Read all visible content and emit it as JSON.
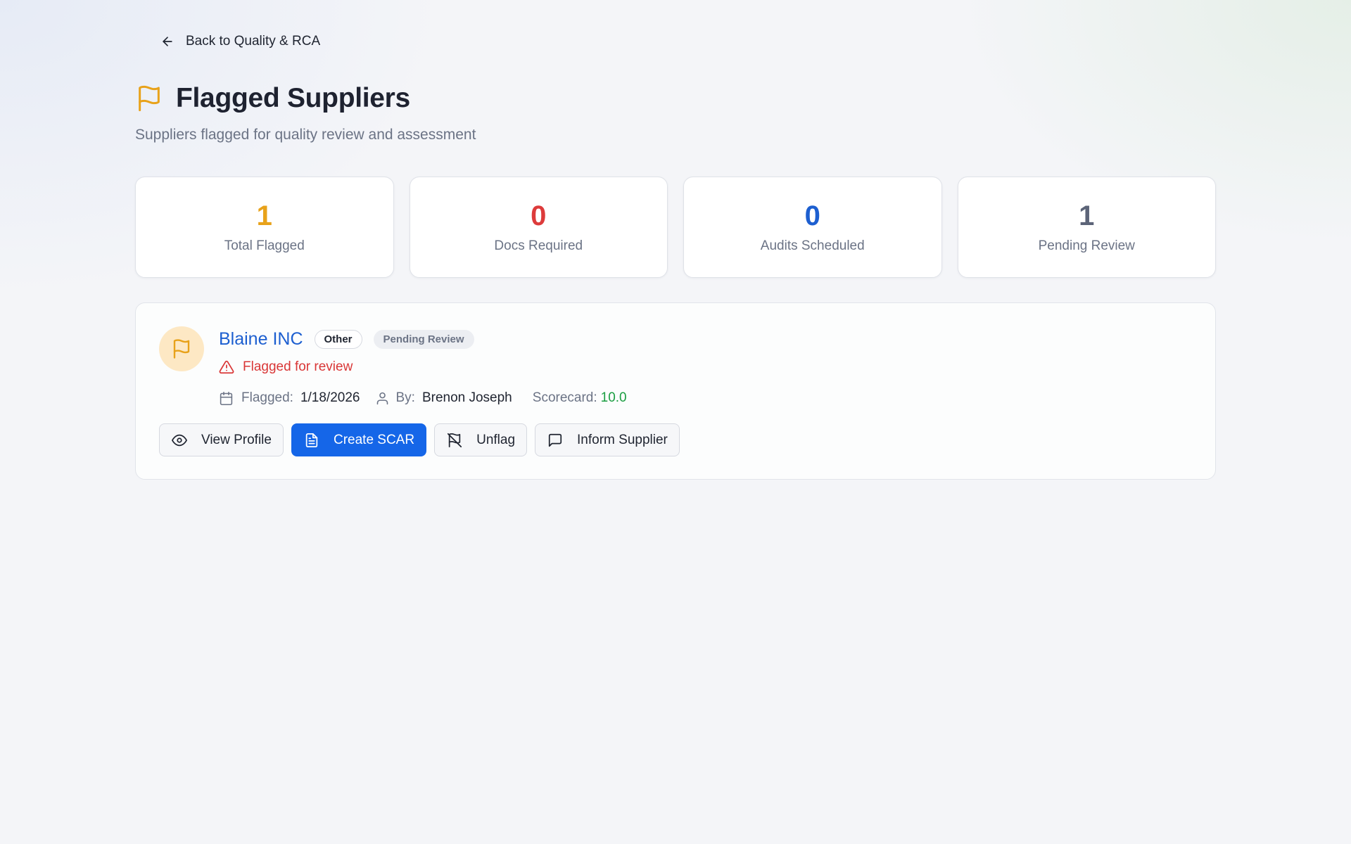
{
  "nav": {
    "back_label": "Back to Quality & RCA"
  },
  "header": {
    "title": "Flagged Suppliers",
    "subtitle": "Suppliers flagged for quality review and assessment"
  },
  "stats": [
    {
      "value": "1",
      "label": "Total Flagged",
      "color": "#e8a21a"
    },
    {
      "value": "0",
      "label": "Docs Required",
      "color": "#dd3b3b"
    },
    {
      "value": "0",
      "label": "Audits Scheduled",
      "color": "#1d5fd0"
    },
    {
      "value": "1",
      "label": "Pending Review",
      "color": "#5c6478"
    }
  ],
  "supplier": {
    "name": "Blaine INC",
    "category": "Other",
    "status": "Pending Review",
    "flag_note": "Flagged for review",
    "flagged_label": "Flagged:",
    "flagged_date": "1/18/2026",
    "by_label": "By:",
    "by_name": "Brenon Joseph",
    "scorecard_label": "Scorecard:",
    "scorecard_value": "10.0",
    "actions": {
      "view_profile": "View Profile",
      "create_scar": "Create SCAR",
      "unflag": "Unflag",
      "inform_supplier": "Inform Supplier"
    }
  },
  "icons": {
    "back": "arrow-left-icon",
    "title": "flag-icon",
    "avatar": "flag-icon",
    "flag_note": "alert-triangle-icon",
    "flagged": "calendar-icon",
    "by": "user-icon",
    "view_profile": "eye-icon",
    "create_scar": "file-text-icon",
    "unflag": "flag-off-icon",
    "inform_supplier": "message-square-icon"
  },
  "colors": {
    "accent": "#1566e8",
    "flag": "#e8a21a",
    "danger": "#d93636",
    "success": "#1b9e42"
  }
}
